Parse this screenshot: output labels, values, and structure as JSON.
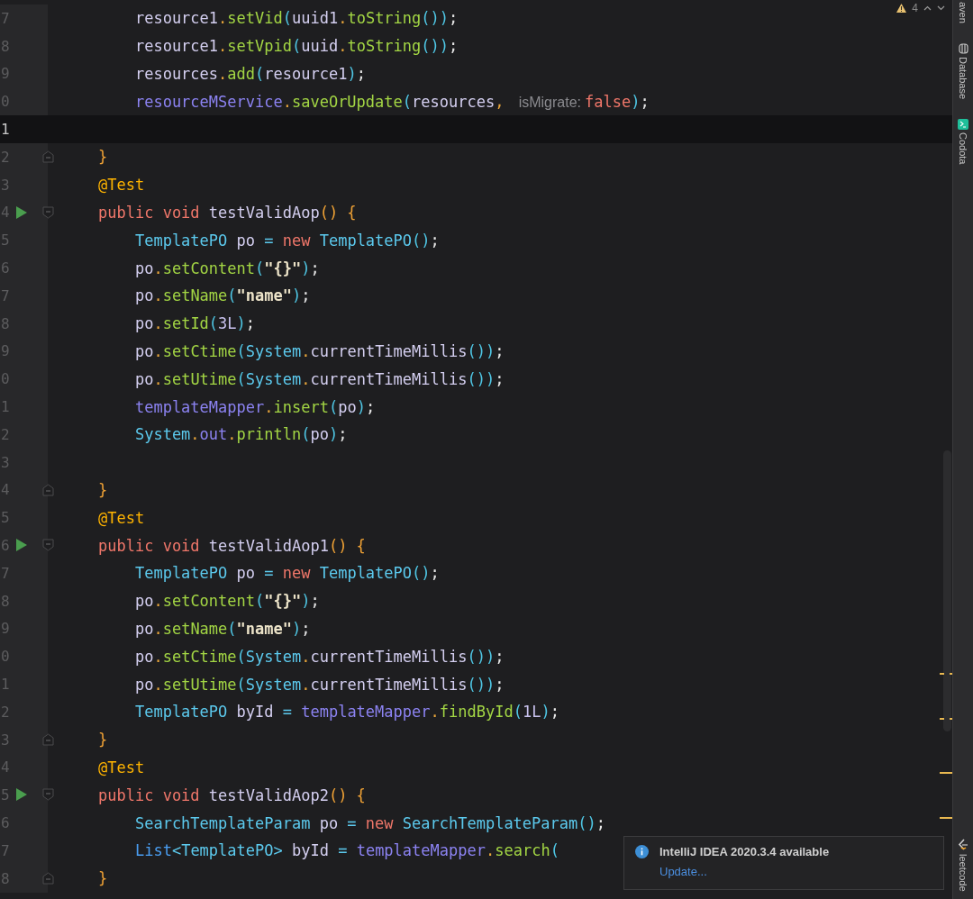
{
  "inspection": {
    "warnings": "4"
  },
  "lines": [
    {
      "number": "7",
      "current": false,
      "run": false,
      "tokens": [
        {
          "kind": "ident",
          "text": "    resource1"
        },
        {
          "kind": "dot",
          "text": "."
        },
        {
          "kind": "method",
          "text": "setVid"
        },
        {
          "kind": "paren",
          "text": "("
        },
        {
          "kind": "ident",
          "text": "uuid1"
        },
        {
          "kind": "dot",
          "text": "."
        },
        {
          "kind": "method",
          "text": "toString"
        },
        {
          "kind": "paren",
          "text": "())"
        },
        {
          "kind": "semi",
          "text": ";"
        }
      ]
    },
    {
      "number": "8",
      "current": false,
      "run": false,
      "tokens": [
        {
          "kind": "ident",
          "text": "    resource1"
        },
        {
          "kind": "dot",
          "text": "."
        },
        {
          "kind": "method",
          "text": "setVpid"
        },
        {
          "kind": "paren",
          "text": "("
        },
        {
          "kind": "ident",
          "text": "uuid"
        },
        {
          "kind": "dot",
          "text": "."
        },
        {
          "kind": "method",
          "text": "toString"
        },
        {
          "kind": "paren",
          "text": "())"
        },
        {
          "kind": "semi",
          "text": ";"
        }
      ]
    },
    {
      "number": "9",
      "current": false,
      "run": false,
      "tokens": [
        {
          "kind": "ident",
          "text": "    resources"
        },
        {
          "kind": "dot",
          "text": "."
        },
        {
          "kind": "method",
          "text": "add"
        },
        {
          "kind": "paren",
          "text": "("
        },
        {
          "kind": "ident",
          "text": "resource1"
        },
        {
          "kind": "paren",
          "text": ")"
        },
        {
          "kind": "semi",
          "text": ";"
        }
      ]
    },
    {
      "number": "0",
      "current": false,
      "run": false,
      "tokens": [
        {
          "kind": "field",
          "text": "    resourceMService"
        },
        {
          "kind": "dot",
          "text": "."
        },
        {
          "kind": "method",
          "text": "saveOrUpdate"
        },
        {
          "kind": "paren",
          "text": "("
        },
        {
          "kind": "ident",
          "text": "resources"
        },
        {
          "kind": "dot",
          "text": ", "
        },
        {
          "kind": "hint",
          "text": "isMigrate:"
        },
        {
          "kind": "keyword",
          "text": "false"
        },
        {
          "kind": "paren",
          "text": ")"
        },
        {
          "kind": "semi",
          "text": ";"
        }
      ]
    },
    {
      "number": "1",
      "current": true,
      "run": false
    },
    {
      "number": "2",
      "current": false,
      "run": false,
      "kind": "fold_end",
      "tokens": [
        {
          "kind": "brace",
          "text": "}"
        }
      ]
    },
    {
      "number": "3",
      "current": false,
      "run": false,
      "tokens": [
        {
          "kind": "annotation",
          "text": "@Test"
        }
      ]
    },
    {
      "number": "4",
      "current": false,
      "run": true,
      "kind": "fold_start",
      "tokens": [
        {
          "kind": "keyword",
          "text": "public void "
        },
        {
          "kind": "ident",
          "text": "testValidAop"
        },
        {
          "kind": "brace",
          "text": "() {"
        }
      ]
    },
    {
      "number": "5",
      "current": false,
      "run": false,
      "tokens": [
        {
          "kind": "type",
          "text": "    TemplatePO"
        },
        {
          "kind": "ident",
          "text": " po "
        },
        {
          "kind": "op",
          "text": "= "
        },
        {
          "kind": "keyword",
          "text": "new "
        },
        {
          "kind": "type",
          "text": "TemplatePO"
        },
        {
          "kind": "paren",
          "text": "()"
        },
        {
          "kind": "semi",
          "text": ";"
        }
      ]
    },
    {
      "number": "6",
      "current": false,
      "run": false,
      "tokens": [
        {
          "kind": "ident",
          "text": "    po"
        },
        {
          "kind": "dot",
          "text": "."
        },
        {
          "kind": "method",
          "text": "setContent"
        },
        {
          "kind": "paren",
          "text": "("
        },
        {
          "kind": "string",
          "text": "\"{}\""
        },
        {
          "kind": "paren",
          "text": ")"
        },
        {
          "kind": "semi",
          "text": ";"
        }
      ]
    },
    {
      "number": "7",
      "current": false,
      "run": false,
      "tokens": [
        {
          "kind": "ident",
          "text": "    po"
        },
        {
          "kind": "dot",
          "text": "."
        },
        {
          "kind": "method",
          "text": "setName"
        },
        {
          "kind": "paren",
          "text": "("
        },
        {
          "kind": "string",
          "text": "\"name\""
        },
        {
          "kind": "paren",
          "text": ")"
        },
        {
          "kind": "semi",
          "text": ";"
        }
      ]
    },
    {
      "number": "8",
      "current": false,
      "run": false,
      "tokens": [
        {
          "kind": "ident",
          "text": "    po"
        },
        {
          "kind": "dot",
          "text": "."
        },
        {
          "kind": "method",
          "text": "setId"
        },
        {
          "kind": "paren",
          "text": "("
        },
        {
          "kind": "number",
          "text": "3L"
        },
        {
          "kind": "paren",
          "text": ")"
        },
        {
          "kind": "semi",
          "text": ";"
        }
      ]
    },
    {
      "number": "9",
      "current": false,
      "run": false,
      "tokens": [
        {
          "kind": "ident",
          "text": "    po"
        },
        {
          "kind": "dot",
          "text": "."
        },
        {
          "kind": "method",
          "text": "setCtime"
        },
        {
          "kind": "paren",
          "text": "("
        },
        {
          "kind": "type",
          "text": "System"
        },
        {
          "kind": "dot",
          "text": "."
        },
        {
          "kind": "ident",
          "text": "currentTimeMillis"
        },
        {
          "kind": "paren",
          "text": "())"
        },
        {
          "kind": "semi",
          "text": ";"
        }
      ]
    },
    {
      "number": "0",
      "current": false,
      "run": false,
      "tokens": [
        {
          "kind": "ident",
          "text": "    po"
        },
        {
          "kind": "dot",
          "text": "."
        },
        {
          "kind": "method",
          "text": "setUtime"
        },
        {
          "kind": "paren",
          "text": "("
        },
        {
          "kind": "type",
          "text": "System"
        },
        {
          "kind": "dot",
          "text": "."
        },
        {
          "kind": "ident",
          "text": "currentTimeMillis"
        },
        {
          "kind": "paren",
          "text": "())"
        },
        {
          "kind": "semi",
          "text": ";"
        }
      ]
    },
    {
      "number": "1",
      "current": false,
      "run": false,
      "tokens": [
        {
          "kind": "field",
          "text": "    templateMapper"
        },
        {
          "kind": "dot",
          "text": "."
        },
        {
          "kind": "method",
          "text": "insert"
        },
        {
          "kind": "paren",
          "text": "("
        },
        {
          "kind": "ident",
          "text": "po"
        },
        {
          "kind": "paren",
          "text": ")"
        },
        {
          "kind": "semi",
          "text": ";"
        }
      ]
    },
    {
      "number": "2",
      "current": false,
      "run": false,
      "tokens": [
        {
          "kind": "type",
          "text": "    System"
        },
        {
          "kind": "dot",
          "text": "."
        },
        {
          "kind": "field",
          "text": "out"
        },
        {
          "kind": "dot",
          "text": "."
        },
        {
          "kind": "method",
          "text": "println"
        },
        {
          "kind": "paren",
          "text": "("
        },
        {
          "kind": "ident",
          "text": "po"
        },
        {
          "kind": "paren",
          "text": ")"
        },
        {
          "kind": "semi",
          "text": ";"
        }
      ]
    },
    {
      "number": "3",
      "current": false,
      "run": false
    },
    {
      "number": "4",
      "current": false,
      "run": false,
      "kind": "fold_end",
      "tokens": [
        {
          "kind": "brace",
          "text": "}"
        }
      ]
    },
    {
      "number": "5",
      "current": false,
      "run": false,
      "tokens": [
        {
          "kind": "annotation",
          "text": "@Test"
        }
      ]
    },
    {
      "number": "6",
      "current": false,
      "run": true,
      "kind": "fold_start",
      "tokens": [
        {
          "kind": "keyword",
          "text": "public void "
        },
        {
          "kind": "ident",
          "text": "testValidAop1"
        },
        {
          "kind": "brace",
          "text": "() {"
        }
      ]
    },
    {
      "number": "7",
      "current": false,
      "run": false,
      "tokens": [
        {
          "kind": "type",
          "text": "    TemplatePO"
        },
        {
          "kind": "ident",
          "text": " po "
        },
        {
          "kind": "op",
          "text": "= "
        },
        {
          "kind": "keyword",
          "text": "new "
        },
        {
          "kind": "type",
          "text": "TemplatePO"
        },
        {
          "kind": "paren",
          "text": "()"
        },
        {
          "kind": "semi",
          "text": ";"
        }
      ]
    },
    {
      "number": "8",
      "current": false,
      "run": false,
      "tokens": [
        {
          "kind": "ident",
          "text": "    po"
        },
        {
          "kind": "dot",
          "text": "."
        },
        {
          "kind": "method",
          "text": "setContent"
        },
        {
          "kind": "paren",
          "text": "("
        },
        {
          "kind": "string",
          "text": "\"{}\""
        },
        {
          "kind": "paren",
          "text": ")"
        },
        {
          "kind": "semi",
          "text": ";"
        }
      ]
    },
    {
      "number": "9",
      "current": false,
      "run": false,
      "tokens": [
        {
          "kind": "ident",
          "text": "    po"
        },
        {
          "kind": "dot",
          "text": "."
        },
        {
          "kind": "method",
          "text": "setName"
        },
        {
          "kind": "paren",
          "text": "("
        },
        {
          "kind": "string",
          "text": "\"name\""
        },
        {
          "kind": "paren",
          "text": ")"
        },
        {
          "kind": "semi",
          "text": ";"
        }
      ]
    },
    {
      "number": "0",
      "current": false,
      "run": false,
      "tokens": [
        {
          "kind": "ident",
          "text": "    po"
        },
        {
          "kind": "dot",
          "text": "."
        },
        {
          "kind": "method",
          "text": "setCtime"
        },
        {
          "kind": "paren",
          "text": "("
        },
        {
          "kind": "type",
          "text": "System"
        },
        {
          "kind": "dot",
          "text": "."
        },
        {
          "kind": "ident",
          "text": "currentTimeMillis"
        },
        {
          "kind": "paren",
          "text": "())"
        },
        {
          "kind": "semi",
          "text": ";"
        }
      ]
    },
    {
      "number": "1",
      "current": false,
      "run": false,
      "tokens": [
        {
          "kind": "ident",
          "text": "    po"
        },
        {
          "kind": "dot",
          "text": "."
        },
        {
          "kind": "method",
          "text": "setUtime"
        },
        {
          "kind": "paren",
          "text": "("
        },
        {
          "kind": "type",
          "text": "System"
        },
        {
          "kind": "dot",
          "text": "."
        },
        {
          "kind": "ident",
          "text": "currentTimeMillis"
        },
        {
          "kind": "paren",
          "text": "())"
        },
        {
          "kind": "semi",
          "text": ";"
        }
      ]
    },
    {
      "number": "2",
      "current": false,
      "run": false,
      "tokens": [
        {
          "kind": "type",
          "text": "    TemplatePO"
        },
        {
          "kind": "ident",
          "text": " byId "
        },
        {
          "kind": "op",
          "text": "= "
        },
        {
          "kind": "field",
          "text": "templateMapper"
        },
        {
          "kind": "dot",
          "text": "."
        },
        {
          "kind": "method",
          "text": "findById"
        },
        {
          "kind": "paren",
          "text": "("
        },
        {
          "kind": "number",
          "text": "1L"
        },
        {
          "kind": "paren",
          "text": ")"
        },
        {
          "kind": "semi",
          "text": ";"
        }
      ]
    },
    {
      "number": "3",
      "current": false,
      "run": false,
      "kind": "fold_end",
      "tokens": [
        {
          "kind": "brace",
          "text": "}"
        }
      ]
    },
    {
      "number": "4",
      "current": false,
      "run": false,
      "tokens": [
        {
          "kind": "annotation",
          "text": "@Test"
        }
      ]
    },
    {
      "number": "5",
      "current": false,
      "run": true,
      "kind": "fold_start",
      "tokens": [
        {
          "kind": "keyword",
          "text": "public void "
        },
        {
          "kind": "ident",
          "text": "testValidAop2"
        },
        {
          "kind": "brace",
          "text": "() {"
        }
      ]
    },
    {
      "number": "6",
      "current": false,
      "run": false,
      "tokens": [
        {
          "kind": "type",
          "text": "    SearchTemplateParam"
        },
        {
          "kind": "ident",
          "text": " po "
        },
        {
          "kind": "op",
          "text": "= "
        },
        {
          "kind": "keyword",
          "text": "new "
        },
        {
          "kind": "type",
          "text": "SearchTemplateParam"
        },
        {
          "kind": "paren",
          "text": "()"
        },
        {
          "kind": "semi",
          "text": ";"
        }
      ]
    },
    {
      "number": "7",
      "current": false,
      "run": false,
      "tokens": [
        {
          "kind": "list",
          "text": "    List"
        },
        {
          "kind": "op",
          "text": "<"
        },
        {
          "kind": "type",
          "text": "TemplatePO"
        },
        {
          "kind": "op",
          "text": ">"
        },
        {
          "kind": "ident",
          "text": " byId "
        },
        {
          "kind": "op",
          "text": "= "
        },
        {
          "kind": "field",
          "text": "templateMapper"
        },
        {
          "kind": "dot",
          "text": "."
        },
        {
          "kind": "method",
          "text": "search"
        },
        {
          "kind": "paren",
          "text": "("
        }
      ]
    },
    {
      "number": "8",
      "current": false,
      "run": false,
      "kind": "fold_end",
      "tokens": [
        {
          "kind": "brace",
          "text": "}"
        }
      ]
    }
  ],
  "notification": {
    "title": "IntelliJ IDEA 2020.3.4 available",
    "link": "Update..."
  },
  "tool_windows": [
    {
      "kind": "maven",
      "label": "aven"
    },
    {
      "kind": "database",
      "label": "Database"
    },
    {
      "kind": "codota",
      "label": "Codota"
    },
    {
      "kind": "leetcode",
      "label": "leetcode"
    }
  ]
}
